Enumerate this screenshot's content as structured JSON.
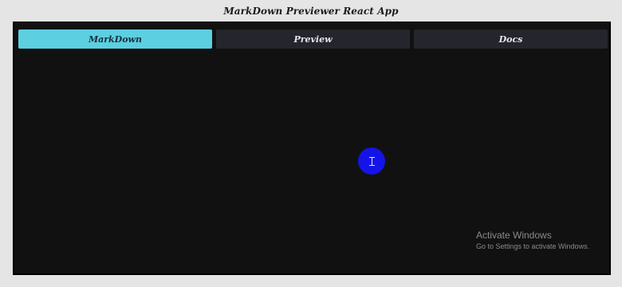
{
  "app": {
    "title": "MarkDown Previewer React App"
  },
  "tabs": [
    {
      "label": "MarkDown",
      "active": true
    },
    {
      "label": "Preview",
      "active": false
    },
    {
      "label": "Docs",
      "active": false
    }
  ],
  "cursor": {
    "icon": "text-cursor-icon"
  },
  "watermark": {
    "title": "Activate Windows",
    "subtitle": "Go to Settings to activate Windows."
  },
  "colors": {
    "page_background": "#e5e5e5",
    "panel_background": "#111111",
    "active_tab": "#5ccfe0",
    "inactive_tab": "#25252d",
    "cursor_highlight": "#1414e8"
  }
}
